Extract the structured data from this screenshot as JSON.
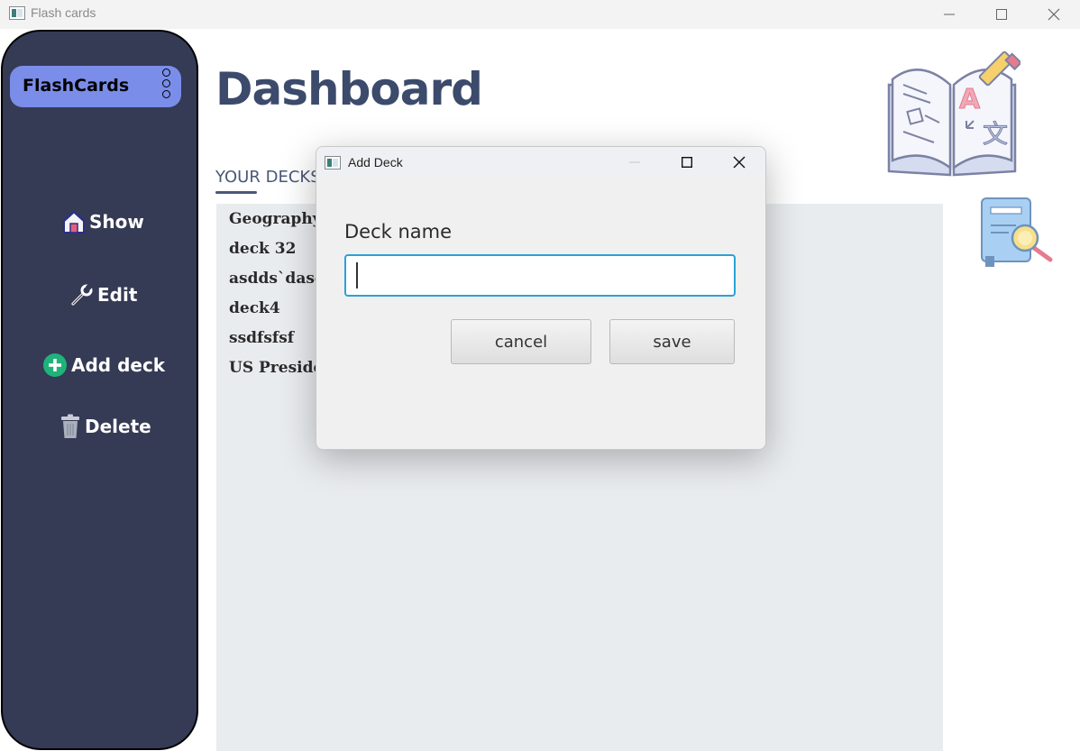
{
  "window": {
    "title": "Flash cards"
  },
  "sidebar": {
    "brand": "FlashCards",
    "items": [
      {
        "label": "Show",
        "icon": "home-icon"
      },
      {
        "label": "Edit",
        "icon": "wrench-icon"
      },
      {
        "label": "Add deck",
        "icon": "plus-circle-icon"
      },
      {
        "label": "Delete",
        "icon": "trash-icon"
      }
    ]
  },
  "main": {
    "title": "Dashboard",
    "section_label": "YOUR DECKS",
    "decks": [
      "Geography",
      "deck 32",
      "asdds`dasds",
      "deck4",
      "ssdfsfsf",
      "US Presidents"
    ]
  },
  "dialog": {
    "title": "Add Deck",
    "field_label": "Deck name",
    "input_value": "",
    "cancel_label": "cancel",
    "save_label": "save"
  },
  "colors": {
    "sidebar_bg": "#353a55",
    "brand_bg": "#7a8de9",
    "title_text": "#3c4a6b",
    "panel_bg": "#e9ecef",
    "input_focus": "#2aa2d6",
    "add_icon": "#1fb27a"
  }
}
